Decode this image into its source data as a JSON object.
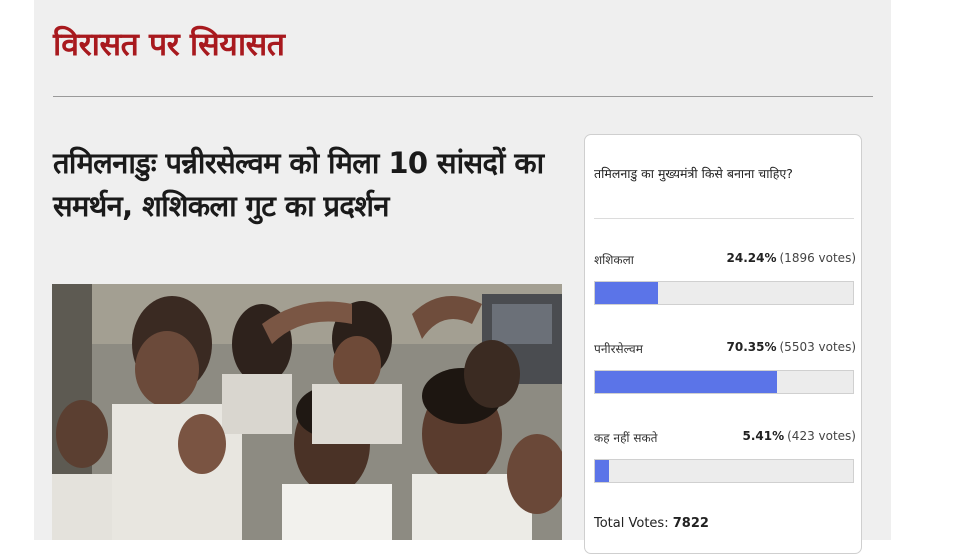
{
  "section": {
    "title": "विरासत पर सियासत"
  },
  "article": {
    "headline": "तमिलनाडुः पन्नीरसेल्वम को मिला 10 सांसदों का समर्थन, शशिकला गुट का प्रदर्शन"
  },
  "poll": {
    "question": "तमिलनाडु का मुख्यमंत्री किसे बनाना चाहिए?",
    "accent_color": "#5b74e8",
    "options": [
      {
        "label": "शशिकला",
        "percent": "24.24%",
        "votes": "(1896 votes)",
        "fraction": 0.2424
      },
      {
        "label": "पनीरसेल्वम",
        "percent": "70.35%",
        "votes": "(5503 votes)",
        "fraction": 0.7035
      },
      {
        "label": "कह नहीं सकते",
        "percent": "5.41%",
        "votes": "(423 votes)",
        "fraction": 0.0541
      }
    ],
    "total_label": "Total Votes:",
    "total_value": "7822"
  },
  "colors": {
    "section_title": "#a8191e",
    "panel_bg": "#efefef"
  }
}
